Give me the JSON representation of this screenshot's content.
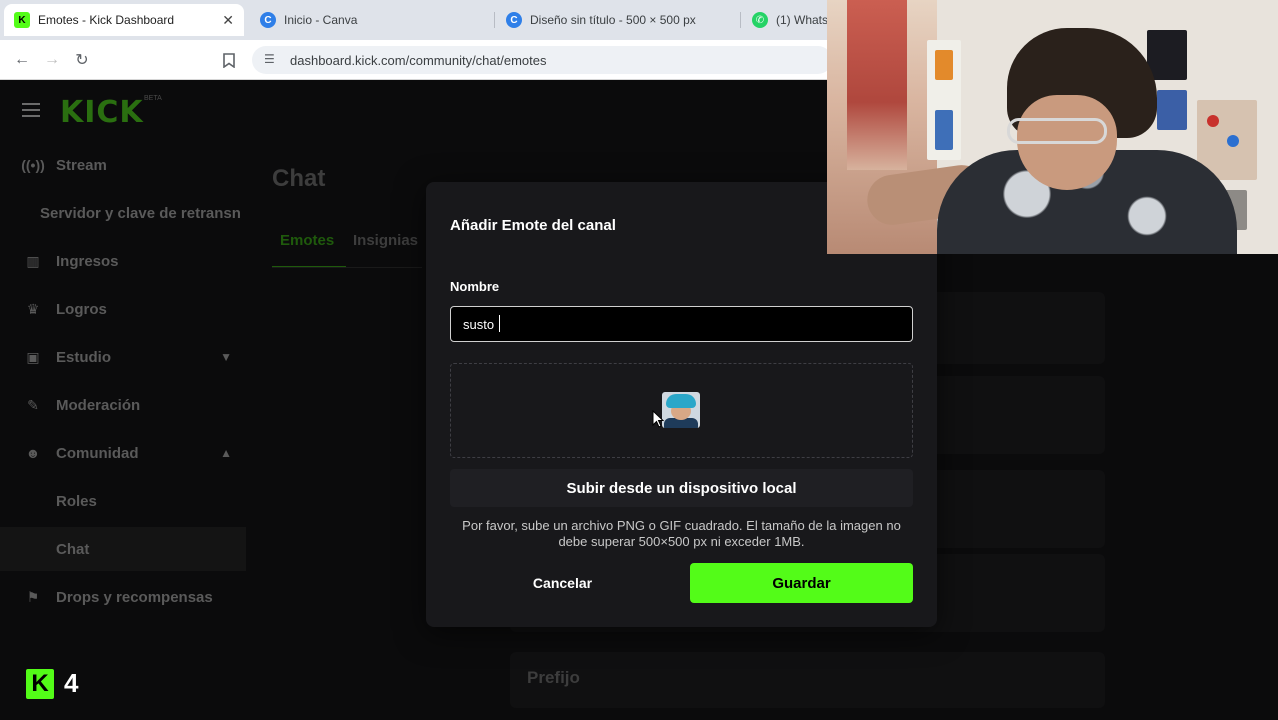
{
  "browser": {
    "tabs": [
      {
        "title": "Emotes - Kick Dashboard",
        "icon": "kick-favicon",
        "active": true
      },
      {
        "title": "Inicio - Canva",
        "icon": "canva-favicon"
      },
      {
        "title": "Diseño sin título - 500 × 500 px",
        "icon": "canva-favicon"
      },
      {
        "title": "(1) Whats",
        "icon": "whatsapp-favicon"
      }
    ],
    "close_symbol": "✕",
    "url": "dashboard.kick.com/community/chat/emotes"
  },
  "sidebar": {
    "logo": "KICK",
    "beta": "BETA",
    "items": [
      {
        "label": "Stream",
        "icon": "broadcast-icon"
      },
      {
        "label": "Servidor y clave de retransn"
      },
      {
        "label": "Ingresos",
        "icon": "chart-icon"
      },
      {
        "label": "Logros",
        "icon": "trophy-icon"
      },
      {
        "label": "Estudio",
        "icon": "studio-icon",
        "chevron": "down"
      },
      {
        "label": "Moderación",
        "icon": "wrench-icon"
      },
      {
        "label": "Comunidad",
        "icon": "community-icon",
        "chevron": "up"
      },
      {
        "label": "Roles"
      },
      {
        "label": "Chat",
        "selected": true
      },
      {
        "label": "Drops y recompensas",
        "icon": "gift-icon"
      }
    ],
    "badge_letter": "K",
    "badge_count": "4"
  },
  "main": {
    "title": "Chat",
    "tabs": [
      "Emotes",
      "Insignias"
    ],
    "active_tab": "Emotes",
    "section_label": "Prefijo"
  },
  "modal": {
    "title": "Añadir Emote del canal",
    "name_label": "Nombre",
    "name_value": "susto",
    "upload_button": "Subir desde un dispositivo local",
    "help_text": "Por favor, sube un archivo PNG o GIF cuadrado. El tamaño de la imagen no debe superar 500×500 px ni exceder 1MB.",
    "cancel": "Cancelar",
    "save": "Guardar"
  },
  "colors": {
    "accent": "#53fc18",
    "modal_bg": "#18181b",
    "page_bg": "#0b0b0c"
  }
}
